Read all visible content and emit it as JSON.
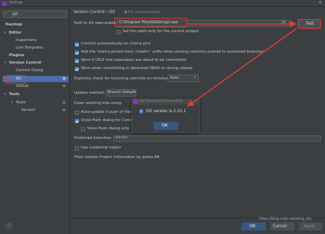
{
  "window": {
    "title": "Settings",
    "close_glyph": "✕"
  },
  "search": {
    "value": "git"
  },
  "sidebar": {
    "items": [
      {
        "label": "Keymap",
        "bold": true
      },
      {
        "label": "Editor",
        "bold": true,
        "expanded": true
      },
      {
        "label": "Inspections"
      },
      {
        "label": "Live Templates"
      },
      {
        "label": "Plugins",
        "bold": true
      },
      {
        "label": "Version Control",
        "bold": true,
        "expanded": true
      },
      {
        "label": "Commit Dialog"
      },
      {
        "label": "Git",
        "selected": true
      },
      {
        "label": "GitHub"
      },
      {
        "label": "Tools",
        "bold": true,
        "expanded": true
      },
      {
        "label": "Tasks",
        "expanded": true
      },
      {
        "label": "Servers"
      }
    ]
  },
  "breadcrumb": {
    "section": "Version Control",
    "separator": "›",
    "page": "Git",
    "scope": "For current project"
  },
  "path": {
    "label": "Path to Git executable:",
    "value": "C:\\Program Files\\Git\\bin\\git.exe",
    "test_label": "Test",
    "only_current_label": "Set this path only for the current project"
  },
  "options": [
    {
      "label": "Commit automatically on cherry-pick",
      "checked": true
    },
    {
      "label": "Add the 'cherry-picked from <hash>' suffix when picking commits pushed to protected branches",
      "checked": true
    },
    {
      "label": "Warn if CRLF line separators are about to be committed",
      "checked": true
    },
    {
      "label": "Warn when committing in detached HEAD or during rebase",
      "checked": true
    }
  ],
  "explicit_check": {
    "label": "Explicitly check for incoming commits on remotes:",
    "value": "Auto"
  },
  "update_method": {
    "label": "Update method:",
    "value": "Branch Default"
  },
  "clean_tree": {
    "label": "Clean working tree using:"
  },
  "auto_update": {
    "label": "Auto-update if push of the",
    "checked": false
  },
  "show_push": {
    "label": "Show Push dialog for Comm",
    "checked": true
  },
  "show_push_only": {
    "label": "Show Push dialog only",
    "checked": false
  },
  "popup": {
    "title": "Git Executed Successfully",
    "message": "Git version is 2.31.1",
    "ok_label": "OK",
    "info_glyph": "i"
  },
  "protected": {
    "label": "Protected branches:",
    "value": "master"
  },
  "credential": {
    "label": "Use credential helper",
    "checked": false
  },
  "filter": {
    "label": "Filter Update Project information by paths:",
    "value": "All"
  },
  "footer": {
    "help": "?",
    "ok": "OK",
    "cancel": "Cancel",
    "apply": "Apply"
  },
  "watermark": "https://blog.csdn.net/zeng_sily",
  "colors": {
    "accent": "#4b6eaf",
    "highlight": "#e23b3b",
    "primary_button": "#365880"
  }
}
